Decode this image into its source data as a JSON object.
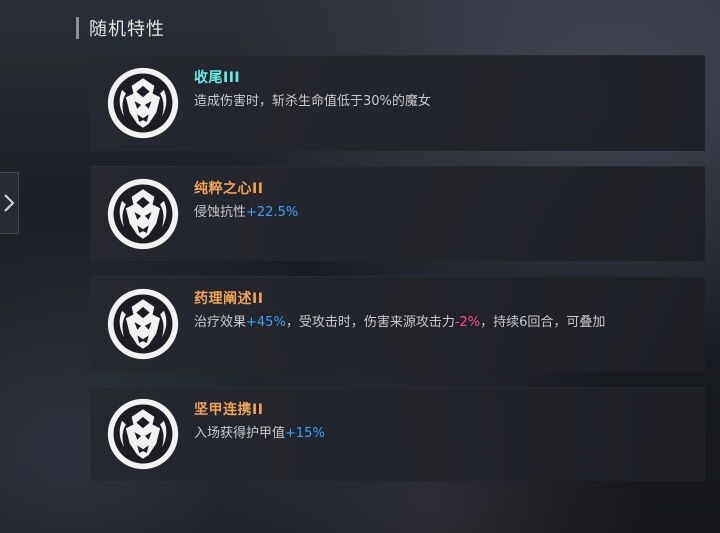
{
  "section": {
    "title": "随机特性"
  },
  "colors": {
    "name_cyan": "#5ff0e6",
    "name_orange": "#f0a357",
    "value_blue": "#3aa0ff",
    "value_pink": "#ff4d8a"
  },
  "traits": [
    {
      "name": "收尾III",
      "name_color": "cyan",
      "icon": "demon-mask-emblem-icon",
      "desc": {
        "text": "造成伤害时，斩杀生命值低于30%的魔女"
      }
    },
    {
      "name": "纯粹之心II",
      "name_color": "orange",
      "icon": "demon-mask-emblem-icon",
      "desc": {
        "prefix": "侵蚀抗性",
        "value": "+22.5%"
      }
    },
    {
      "name": "药理阐述II",
      "name_color": "orange",
      "icon": "demon-mask-emblem-icon",
      "desc": {
        "prefix": "治疗效果",
        "value1": "+45%",
        "mid": "，受攻击时，伤害来源攻击力",
        "value2": "-2%",
        "suffix": "，持续6回合，可叠加"
      }
    },
    {
      "name": "坚甲连携II",
      "name_color": "orange",
      "icon": "demon-mask-emblem-icon",
      "desc": {
        "prefix": "入场获得护甲值",
        "value": "+15%"
      }
    }
  ]
}
